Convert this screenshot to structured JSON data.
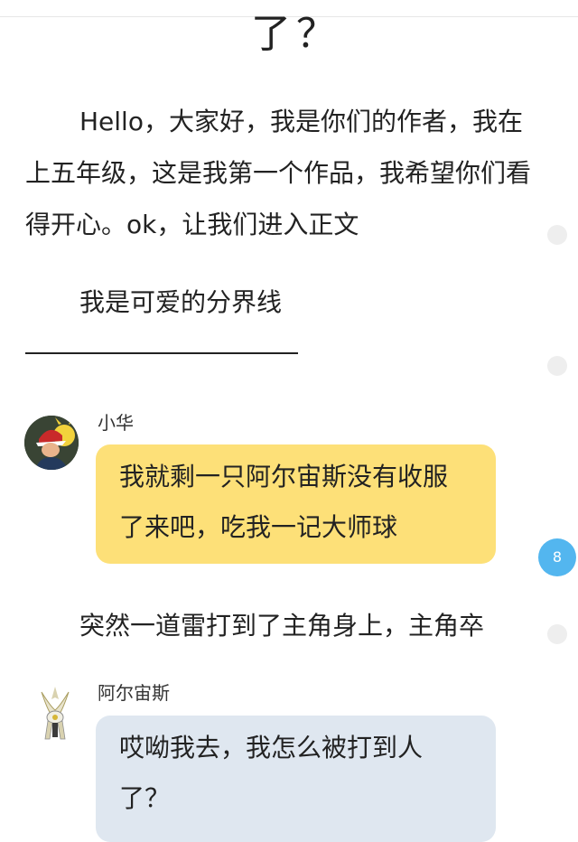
{
  "story": {
    "title_tail": "了？",
    "intro_lines": [
      "Hello，大家好，我是你们的作者，我在上五年级，这是我第一个作品，我希望你们看得开心。ok，让我们进入正文"
    ],
    "divider_text": "我是可爱的分界线",
    "narration": "突然一道雷打到了主角身上，主角卒"
  },
  "messages": [
    {
      "sender": "小华",
      "text": "我就剩一只阿尔宙斯没有收服了来吧，吃我一记大师球",
      "bubble_color": "#fde078"
    },
    {
      "sender": "阿尔宙斯",
      "text": "哎呦我去，我怎么被打到人了？",
      "bubble_color": "#dfe7f0"
    }
  ],
  "comment_count": "8",
  "colors": {
    "badge": "#53b6ef",
    "comment_dot": "#eeeeee"
  }
}
